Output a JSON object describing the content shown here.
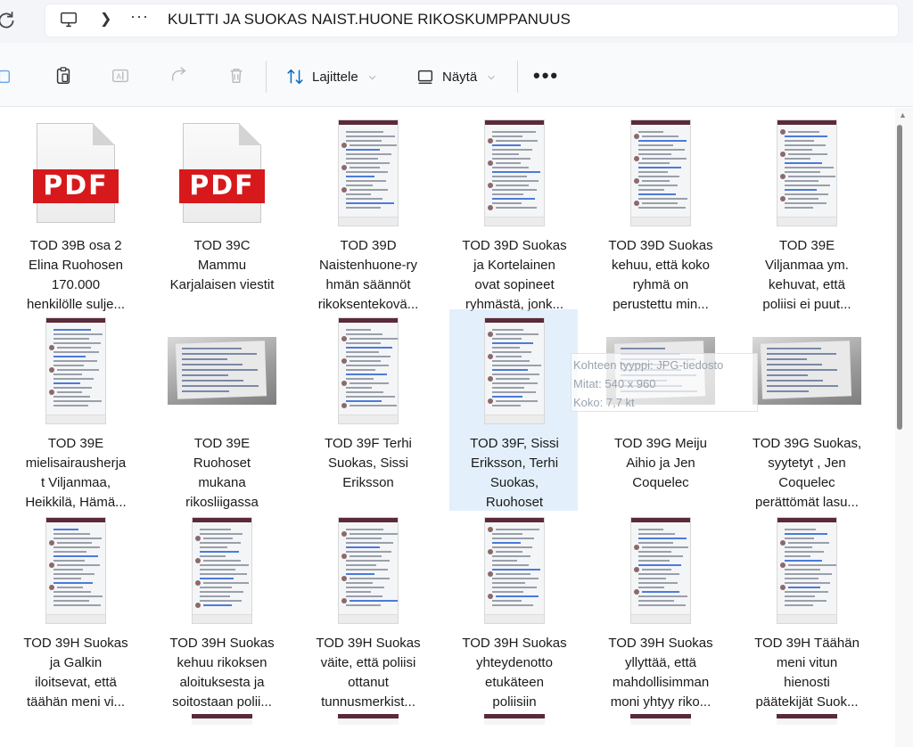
{
  "address_bar": {
    "breadcrumb_overflow": "···",
    "folder_title": "KULTTI JA SUOKAS NAIST.HUONE RIKOSKUMPPANUUS"
  },
  "toolbar": {
    "sort_label": "Lajittele",
    "view_label": "Näytä",
    "more_label": "•••"
  },
  "tooltip": {
    "type": "Kohteen tyyppi: JPG-tiedosto",
    "dims": "Mitat: 540 x 960",
    "size": "Koko: 7,7 kt"
  },
  "files": [
    {
      "kind": "pdf",
      "lines": [
        "TOD 39B osa 2",
        "Elina Ruohosen",
        "170.000",
        "henkilölle sulje..."
      ]
    },
    {
      "kind": "pdf",
      "lines": [
        "TOD 39C",
        "Mammu",
        "Karjalaisen viestit"
      ]
    },
    {
      "kind": "phone",
      "lines": [
        "TOD 39D",
        "Naistenhuone-ry",
        "hmän säännöt",
        "rikoksentekovä..."
      ]
    },
    {
      "kind": "phone",
      "lines": [
        "TOD 39D Suokas",
        "ja Kortelainen",
        "ovat sopineet",
        "ryhmästä, jonk..."
      ]
    },
    {
      "kind": "phone",
      "lines": [
        "TOD 39D Suokas",
        "kehuu, että koko",
        "ryhmä on",
        "perustettu min..."
      ]
    },
    {
      "kind": "phone",
      "lines": [
        "TOD 39E",
        "Viljanmaa ym.",
        "kehuvat, että",
        "poliisi ei puut..."
      ]
    },
    {
      "kind": "phone",
      "lines": [
        "TOD 39E",
        "mielisairausherja",
        "t Viljanmaa,",
        "Heikkilä, Hämä..."
      ]
    },
    {
      "kind": "photo",
      "lines": [
        "TOD 39E",
        "Ruohoset",
        "mukana",
        "rikosliigassa"
      ]
    },
    {
      "kind": "phone",
      "lines": [
        "TOD 39F Terhi",
        "Suokas, Sissi",
        "Eriksson"
      ]
    },
    {
      "kind": "phone",
      "lines": [
        "TOD 39F, Sissi",
        "Eriksson, Terhi",
        "Suokas,",
        "Ruohoset"
      ]
    },
    {
      "kind": "photo",
      "lines": [
        "TOD 39G Meiju",
        "Aihio ja Jen",
        "Coquelec"
      ]
    },
    {
      "kind": "photo",
      "lines": [
        "TOD 39G Suokas,",
        "syytetyt , Jen",
        "Coquelec",
        "perättömät lasu..."
      ]
    },
    {
      "kind": "phone",
      "lines": [
        "TOD 39H Suokas",
        "ja Galkin",
        "iloitsevat, että",
        "täähän meni vi..."
      ]
    },
    {
      "kind": "phone",
      "lines": [
        "TOD 39H Suokas",
        "kehuu rikoksen",
        "aloituksesta ja",
        "soitostaan polii..."
      ]
    },
    {
      "kind": "phone",
      "lines": [
        "TOD 39H Suokas",
        "väite, että poliisi",
        "ottanut",
        "tunnusmerkist..."
      ]
    },
    {
      "kind": "phone",
      "lines": [
        "TOD 39H Suokas",
        "yhteydenotto",
        "etukäteen",
        "poliisiin"
      ]
    },
    {
      "kind": "phone",
      "lines": [
        "TOD 39H Suokas",
        "yllyttää, että",
        "mahdollisimman",
        "moni yhtyy riko..."
      ]
    },
    {
      "kind": "phone",
      "lines": [
        "TOD 39H Täähän",
        "meni vitun",
        "hienosti",
        "päätekijät Suok..."
      ]
    }
  ],
  "selected_index": 9,
  "colors": {
    "accent": "#0067c0",
    "pdf_red": "#d7191c",
    "selection": "#cce4f7"
  }
}
